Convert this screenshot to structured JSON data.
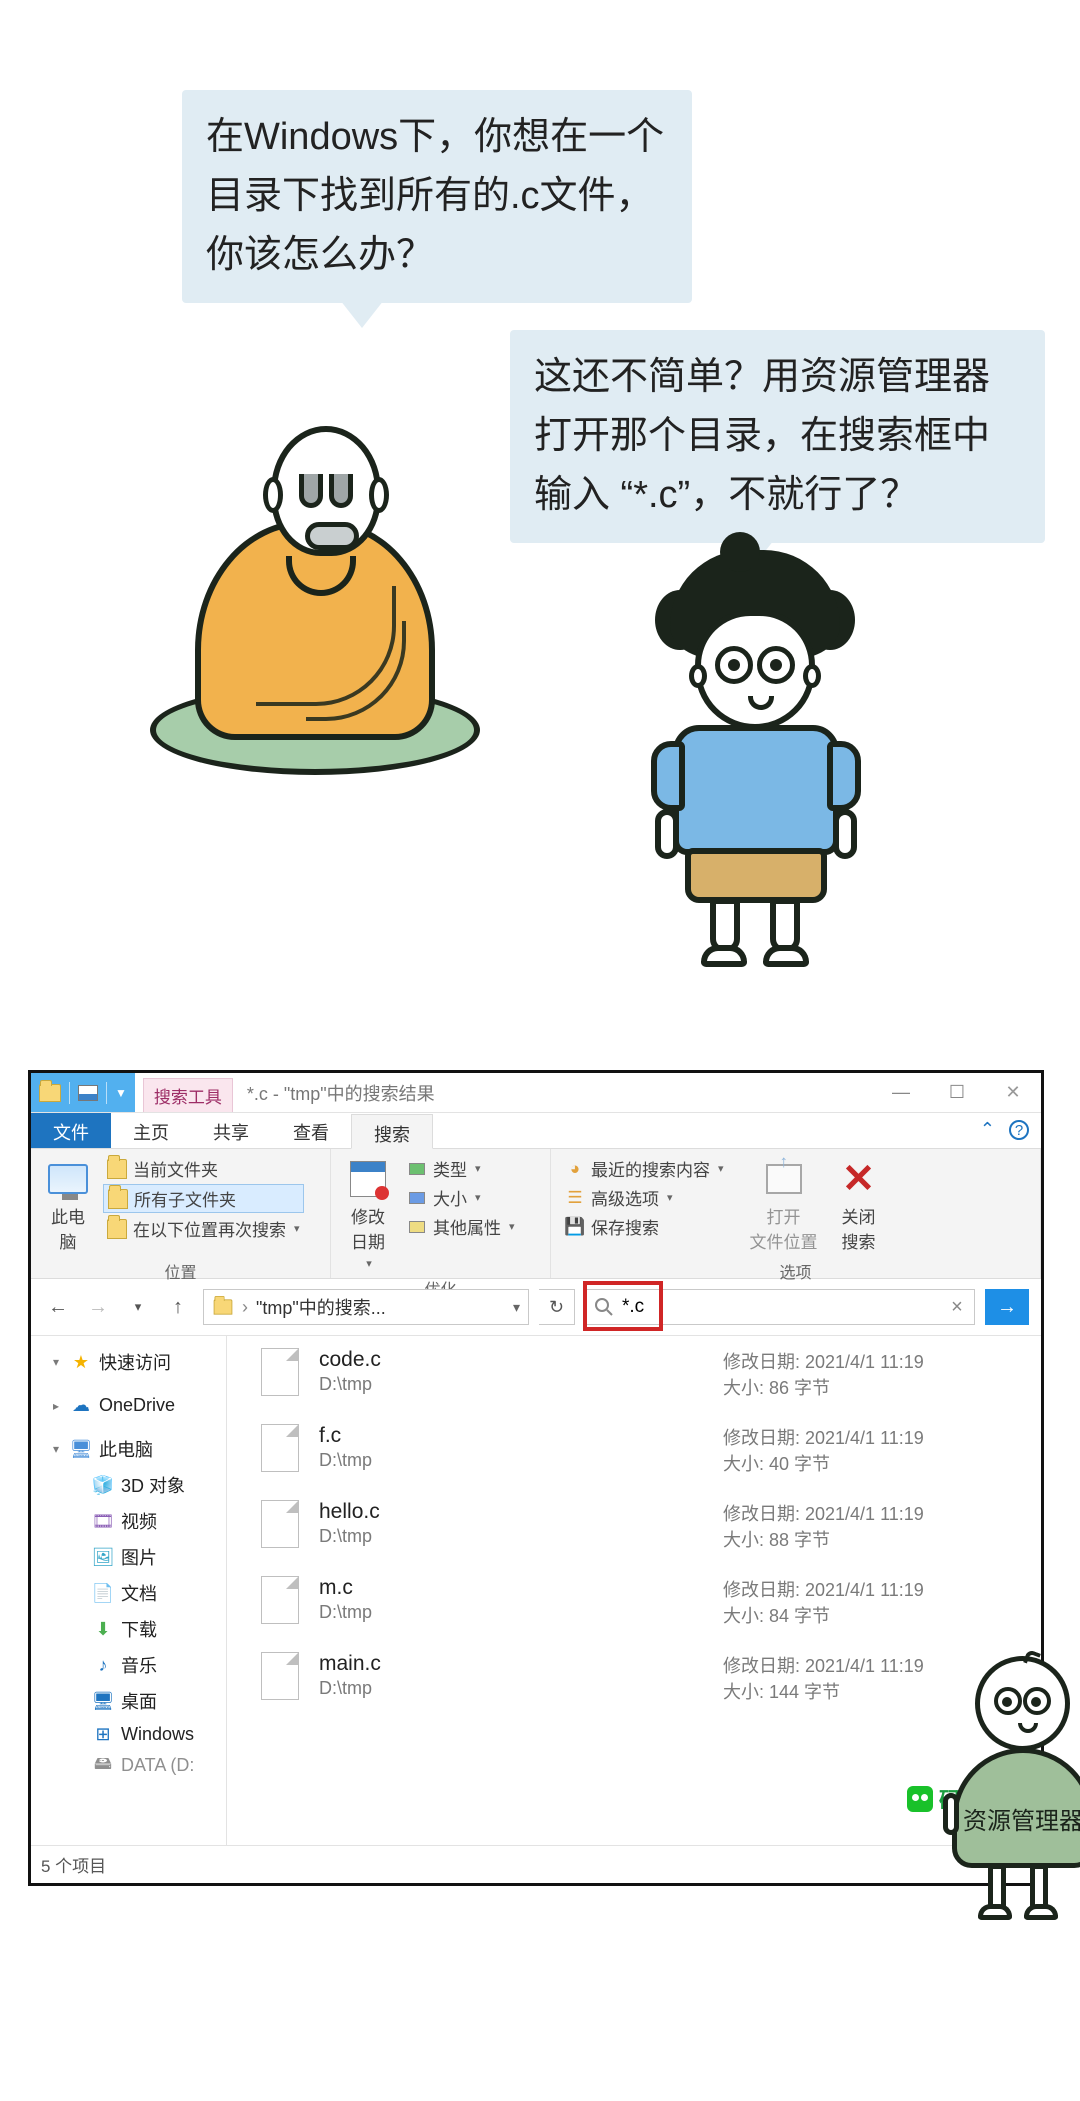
{
  "comic": {
    "bubble1": "在Windows下，你想在一个目录下找到所有的.c文件，你该怎么办？",
    "bubble2": "这还不简单？用资源管理器打开那个目录，在搜索框中输入 “*.c”，不就行了？"
  },
  "explorer": {
    "title_tool_tab": "搜索工具",
    "title": "*.c - \"tmp\"中的搜索结果",
    "window_buttons": {
      "min": "—",
      "max": "☐",
      "close": "✕"
    },
    "ribbon_tabs": {
      "file": "文件",
      "home": "主页",
      "share": "共享",
      "view": "查看",
      "search": "搜索"
    },
    "help_caret": "ㅿ",
    "ribbon": {
      "location": {
        "this_pc": "此电\n脑",
        "current_folder": "当前文件夹",
        "all_subfolders": "所有子文件夹",
        "search_again_in": "在以下位置再次搜索",
        "group": "位置"
      },
      "refine": {
        "mod_date": "修改\n日期",
        "kind": "类型",
        "size": "大小",
        "other": "其他属性",
        "group": "优化"
      },
      "options": {
        "recent": "最近的搜索内容",
        "advanced": "高级选项",
        "save": "保存搜索",
        "open_loc": "打开\n文件位置",
        "close_search": "关闭\n搜索",
        "group": "选项"
      }
    },
    "nav": {
      "back": "←",
      "fwd": "→",
      "up": "↑",
      "refresh": "↻",
      "breadcrumb": "\"tmp\"中的搜索...",
      "breadcrumb_caret": "▾",
      "search_value": "*.c",
      "clear": "×",
      "go": "→"
    },
    "sidebar": [
      {
        "icon": "star",
        "label": "快速访问",
        "exp": true
      },
      {
        "icon": "cloud",
        "label": "OneDrive",
        "exp": false
      },
      {
        "icon": "pc",
        "label": "此电脑",
        "exp": true
      },
      {
        "icon": "3d",
        "label": "3D 对象",
        "sub": true
      },
      {
        "icon": "vid",
        "label": "视频",
        "sub": true
      },
      {
        "icon": "img",
        "label": "图片",
        "sub": true
      },
      {
        "icon": "doc",
        "label": "文档",
        "sub": true
      },
      {
        "icon": "dl",
        "label": "下载",
        "sub": true
      },
      {
        "icon": "mus",
        "label": "音乐",
        "sub": true
      },
      {
        "icon": "desk",
        "label": "桌面",
        "sub": true
      },
      {
        "icon": "win",
        "label": "Windows",
        "sub": true
      },
      {
        "icon": "data",
        "label": "DATA (D:",
        "sub": true,
        "cut": true
      }
    ],
    "files": [
      {
        "name": "code.c",
        "path": "D:\\tmp",
        "mod_label": "修改日期:",
        "mod": "2021/4/1 11:19",
        "size_label": "大小:",
        "size": "86 字节"
      },
      {
        "name": "f.c",
        "path": "D:\\tmp",
        "mod_label": "修改日期:",
        "mod": "2021/4/1 11:19",
        "size_label": "大小:",
        "size": "40 字节"
      },
      {
        "name": "hello.c",
        "path": "D:\\tmp",
        "mod_label": "修改日期:",
        "mod": "2021/4/1 11:19",
        "size_label": "大小:",
        "size": "88 字节"
      },
      {
        "name": "m.c",
        "path": "D:\\tmp",
        "mod_label": "修改日期:",
        "mod": "2021/4/1 11:19",
        "size_label": "大小:",
        "size": "84 字节"
      },
      {
        "name": "main.c",
        "path": "D:\\tmp",
        "mod_label": "修改日期:",
        "mod": "2021/4/1 11:19",
        "size_label": "大小:",
        "size": "144 字节"
      }
    ],
    "status": "5 个项目",
    "watermark": "码农翻身"
  },
  "mascot_label": "资源管理器"
}
